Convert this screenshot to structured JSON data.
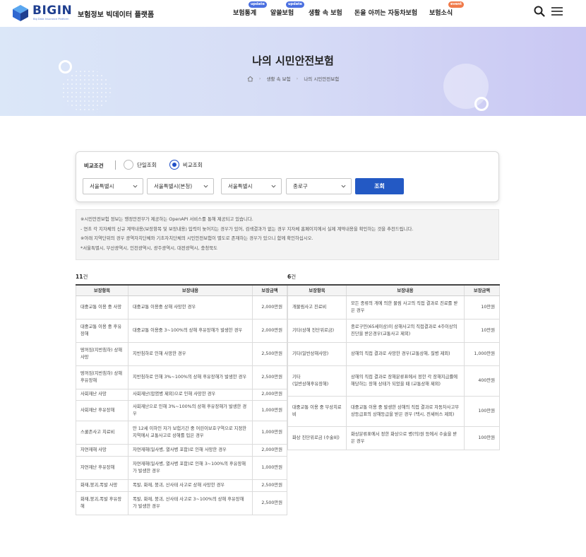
{
  "header": {
    "logo_text": "BIGIN",
    "logo_sub": "Big Data Insurance Platform",
    "logo_desc": "보험정보 빅데이터 플랫폼",
    "nav": [
      {
        "label": "보험통계",
        "badge": "update"
      },
      {
        "label": "알쓸보험",
        "badge": "update"
      },
      {
        "label": "생활 속 보험",
        "badge": ""
      },
      {
        "label": "돈을 아끼는 자동차보험",
        "badge": ""
      },
      {
        "label": "보험소식",
        "badge": "event"
      }
    ]
  },
  "hero": {
    "title": "나의 시민안전보험",
    "breadcrumb": [
      "생활 속 보험",
      "나의 시민안전보험"
    ]
  },
  "filter": {
    "label": "비교조건",
    "options": [
      "단일조회",
      "비교조회"
    ],
    "selected_option": "비교조회",
    "selects": [
      "서울특별시",
      "서울특별시(본청)",
      "서울특별시",
      "종로구"
    ],
    "search_label": "조회"
  },
  "notice": [
    "※시민안전보험 정보는 행정안전부가 제공하는 OpenAPI 서비스를 통해 제공되고 있습니다.",
    "- 연초 각 지자체의 신규 계약내용(보장항목 및 보장내용) 입력이 늦어지는 경우가 있어, 검색결과가 없는 경우 지자체 홈페이지에서 실제 계약내용을 확인하는 것을 추천드립니다.",
    "※아래 지역단위의 경우 광역자치단체와 기초자치단체의 시민안전보험이 별도로 존재하는 경우가 있으니 함께 확인하십시오.",
    "*서울특별시, 부산광역시, 인천광역시, 광주광역시, 대전광역시, 충청북도"
  ],
  "tables": [
    {
      "count_num": "11",
      "count_unit": "건",
      "headers": [
        "보장항목",
        "보장내용",
        "보장금액"
      ],
      "rows": [
        [
          "대중교통 이용 중 사망",
          "대중교통 이용중 상해 사망한 경우",
          "2,000만원"
        ],
        [
          "대중교통 이용 중 후유장해",
          "대중교통 이용중 3~100%의 상해 후유장해가 발생한 경우",
          "2,000만원"
        ],
        [
          "땅꺼짐(지반침하) 상해 사망",
          "지반침하로 인해 사망한 경우",
          "2,500만원"
        ],
        [
          "땅꺼짐(지반침하) 상해 후유장해",
          "지반침하로 인해 3%~100%의 상해 후유장해가 발생한 경우",
          "2,500만원"
        ],
        [
          "사회재난 사망",
          "사회재난(압염병 제외)으로 인해 사망한 경우",
          "2,000만원"
        ],
        [
          "사회재난 후유장해",
          "사회재난으로 인해 3%~100%의 상해 후유장해가 발생한 경우",
          "1,000만원"
        ],
        [
          "스쿨존사고 치료비",
          "만 12세 이하인 자가 보험기간 중 어린이보호구역으로 지정한 지역에서 교통사고로 상해를 입은 경우",
          "1,000만원"
        ],
        [
          "자연재해 사망",
          "자연재해(일사병, 열사병 포함)로 인해 사망한 경우",
          "2,000만원"
        ],
        [
          "자연재난 후유장해",
          "자연재해(일사병, 열사병 포함)로 인해 3~100%의 후유장해가 발생한 경우",
          "1,000만원"
        ],
        [
          "화재,붕괴,폭발 사망",
          "폭발, 화재, 붕괴, 산사태 사고로 상해 사망한 경우",
          "2,500만원"
        ],
        [
          "화재,붕괴,폭발 후유장해",
          "폭발, 화재, 붕괴, 산사태 사고로 3~100%의 상해 후유장해가 발생한 경우",
          "2,500만원"
        ]
      ]
    },
    {
      "count_num": "6",
      "count_unit": "건",
      "headers": [
        "보장항목",
        "보장내용",
        "보장금액"
      ],
      "rows": [
        [
          "개물림사고 진료비",
          "모든 종류의 개에 의한 물림 사고의 직접 결과로 진료를 받은 경우",
          "10만원"
        ],
        [
          "기타(상해 진단위로금)",
          "종로구민(65세이상)이 상해사고의 직접결과로 4주이상의 진단을 받은경우(교통사고 제외)",
          "10만원"
        ],
        [
          "기타(일반상해사망)",
          "상해의 직접 결과로 사망한 경우(교통상해, 질병 제외)",
          "1,000만원"
        ],
        [
          "기타\n(일반상해후유장해)",
          "상해의 직접 결과로 장해분류표에서 정한 각 장해지급률에 해당하는 장해 상태가 되었을 때 (교통상해 제외)",
          "400만원"
        ],
        [
          "대중교통 이용 중 부상치료비",
          "대중교통 이용 중 발생한 상해의 직접 결과로 자동차사고부상등급표의 상해등급을 받은 경우 (택시, 전세버스 제외)",
          "100만원"
        ],
        [
          "화상 진단위로금 (수술비)",
          "화상분류표에서 정한 화상으로 병(의)원 등에서 수술을 받은 경우",
          "100만원"
        ]
      ]
    }
  ]
}
